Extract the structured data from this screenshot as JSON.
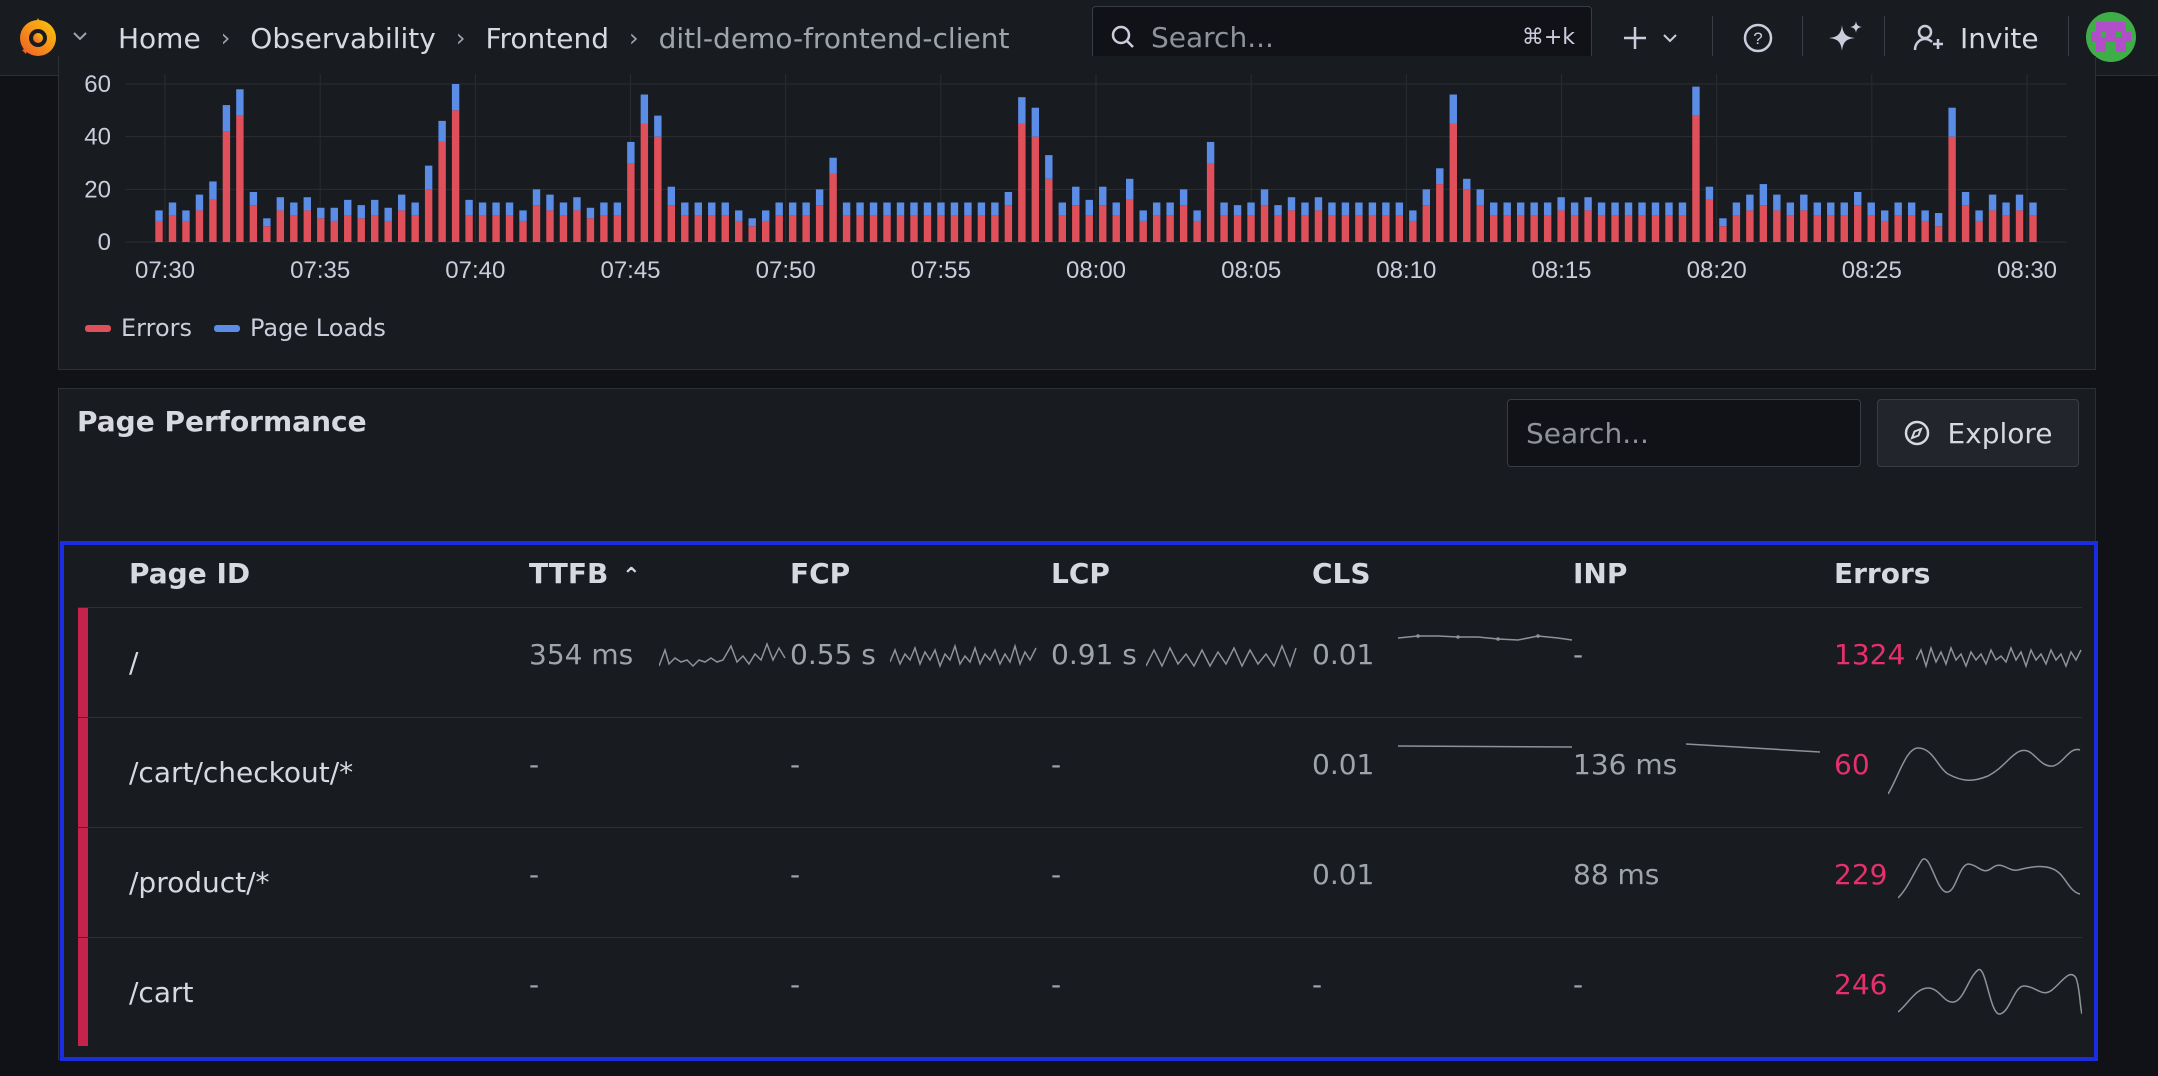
{
  "nav": {
    "breadcrumbs": [
      "Home",
      "Observability",
      "Frontend",
      "ditl-demo-frontend-client"
    ],
    "search_placeholder": "Search...",
    "search_shortcut": "⌘+k",
    "invite_label": "Invite",
    "icons": [
      "grafana-logo",
      "chevron-down-icon",
      "search-icon",
      "plus-icon",
      "help-icon",
      "sparkle-icon",
      "invite-user-icon",
      "avatar"
    ]
  },
  "chart_data": {
    "type": "bar",
    "stacked": true,
    "x_ticks": [
      "07:30",
      "07:35",
      "07:40",
      "07:45",
      "07:50",
      "07:55",
      "08:00",
      "08:05",
      "08:10",
      "08:15",
      "08:20",
      "08:25",
      "08:30"
    ],
    "y_ticks": [
      "0",
      "20",
      "40",
      "60"
    ],
    "ylim": [
      0,
      60
    ],
    "legend": "bottom-left",
    "grid": true,
    "series": [
      {
        "name": "Errors",
        "color": "#e0505a",
        "values": [
          8,
          10,
          8,
          12,
          16,
          42,
          48,
          14,
          6,
          12,
          10,
          12,
          9,
          8,
          10,
          9,
          10,
          8,
          12,
          10,
          20,
          38,
          50,
          10,
          10,
          10,
          10,
          8,
          14,
          12,
          10,
          12,
          9,
          10,
          10,
          30,
          45,
          40,
          14,
          10,
          10,
          10,
          10,
          8,
          6,
          8,
          10,
          10,
          10,
          14,
          26,
          10,
          10,
          10,
          10,
          10,
          10,
          10,
          10,
          10,
          10,
          10,
          10,
          14,
          45,
          40,
          24,
          10,
          14,
          10,
          14,
          10,
          16,
          8,
          10,
          10,
          14,
          8,
          30,
          10,
          10,
          10,
          14,
          10,
          12,
          10,
          12,
          10,
          10,
          10,
          10,
          10,
          10,
          8,
          14,
          22,
          45,
          20,
          14,
          10,
          10,
          10,
          10,
          10,
          12,
          10,
          12,
          10,
          10,
          10,
          10,
          10,
          10,
          10,
          48,
          16,
          6,
          10,
          12,
          14,
          12,
          10,
          12,
          10,
          10,
          10,
          14,
          10,
          8,
          10,
          10,
          8,
          6,
          40,
          14,
          8,
          12,
          10,
          12,
          10
        ]
      },
      {
        "name": "Page Loads",
        "color": "#5b8ce6",
        "values": [
          4,
          5,
          4,
          6,
          7,
          10,
          10,
          5,
          3,
          5,
          5,
          5,
          4,
          5,
          6,
          5,
          6,
          5,
          6,
          5,
          9,
          8,
          10,
          6,
          5,
          5,
          5,
          4,
          6,
          6,
          5,
          5,
          4,
          5,
          5,
          8,
          11,
          8,
          7,
          5,
          5,
          5,
          5,
          4,
          3,
          4,
          5,
          5,
          5,
          6,
          6,
          5,
          5,
          5,
          5,
          5,
          5,
          5,
          5,
          5,
          5,
          5,
          5,
          5,
          10,
          11,
          9,
          5,
          7,
          6,
          7,
          5,
          8,
          4,
          5,
          5,
          6,
          4,
          8,
          5,
          4,
          5,
          6,
          4,
          5,
          5,
          5,
          5,
          5,
          5,
          5,
          5,
          5,
          4,
          6,
          6,
          11,
          4,
          6,
          5,
          5,
          5,
          5,
          5,
          5,
          5,
          5,
          5,
          5,
          5,
          5,
          5,
          5,
          5,
          11,
          5,
          3,
          5,
          6,
          8,
          6,
          5,
          6,
          5,
          5,
          5,
          5,
          5,
          4,
          5,
          5,
          4,
          5,
          11,
          5,
          4,
          6,
          5,
          6,
          5
        ]
      }
    ]
  },
  "legend": [
    {
      "label": "Errors",
      "color": "#e0505a"
    },
    {
      "label": "Page Loads",
      "color": "#5b8ce6"
    }
  ],
  "perf": {
    "title": "Page Performance",
    "search_placeholder": "Search...",
    "explore_label": "Explore",
    "columns": [
      "Page ID",
      "TTFB",
      "FCP",
      "LCP",
      "CLS",
      "INP",
      "Errors"
    ],
    "sort_indicator": "⌃",
    "rows": [
      {
        "page_id": "/",
        "ttfb": "354 ms",
        "fcp": "0.55 s",
        "lcp": "0.91 s",
        "cls": "0.01",
        "inp": "-",
        "errors": "1324",
        "spark": {
          "ttfb": true,
          "fcp": true,
          "lcp": true,
          "cls": true,
          "inp": false,
          "errors": true
        }
      },
      {
        "page_id": "/cart/checkout/*",
        "ttfb": "-",
        "fcp": "-",
        "lcp": "-",
        "cls": "0.01",
        "inp": "136 ms",
        "errors": "60",
        "spark": {
          "ttfb": false,
          "fcp": false,
          "lcp": false,
          "cls": true,
          "inp": true,
          "errors": true
        }
      },
      {
        "page_id": "/product/*",
        "ttfb": "-",
        "fcp": "-",
        "lcp": "-",
        "cls": "0.01",
        "inp": "88 ms",
        "errors": "229",
        "spark": {
          "ttfb": false,
          "fcp": false,
          "lcp": false,
          "cls": false,
          "inp": false,
          "errors": true
        }
      },
      {
        "page_id": "/cart",
        "ttfb": "-",
        "fcp": "-",
        "lcp": "-",
        "cls": "-",
        "inp": "-",
        "errors": "246",
        "spark": {
          "ttfb": false,
          "fcp": false,
          "lcp": false,
          "cls": false,
          "inp": false,
          "errors": true
        }
      }
    ]
  }
}
